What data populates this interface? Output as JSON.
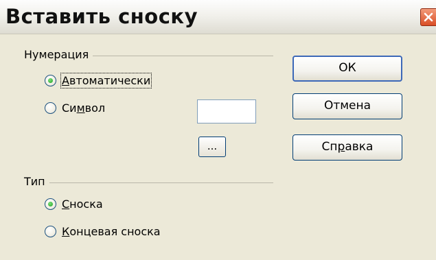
{
  "window": {
    "title": "Вставить сноску"
  },
  "numbering": {
    "label": "Нумерация",
    "options": [
      {
        "pre": "",
        "accel": "А",
        "post": "втоматически",
        "checked": true
      },
      {
        "pre": "Си",
        "accel": "м",
        "post": "вол",
        "checked": false
      }
    ],
    "symbol_value": "",
    "browse_label": "..."
  },
  "type": {
    "label": "Тип",
    "options": [
      {
        "pre": "",
        "accel": "С",
        "post": "носка",
        "checked": true
      },
      {
        "pre": "",
        "accel": "К",
        "post": "онцевая сноска",
        "checked": false
      }
    ]
  },
  "buttons": {
    "ok": "ОК",
    "cancel": "Отмена",
    "help_pre": "Сп",
    "help_accel": "р",
    "help_post": "авка"
  }
}
